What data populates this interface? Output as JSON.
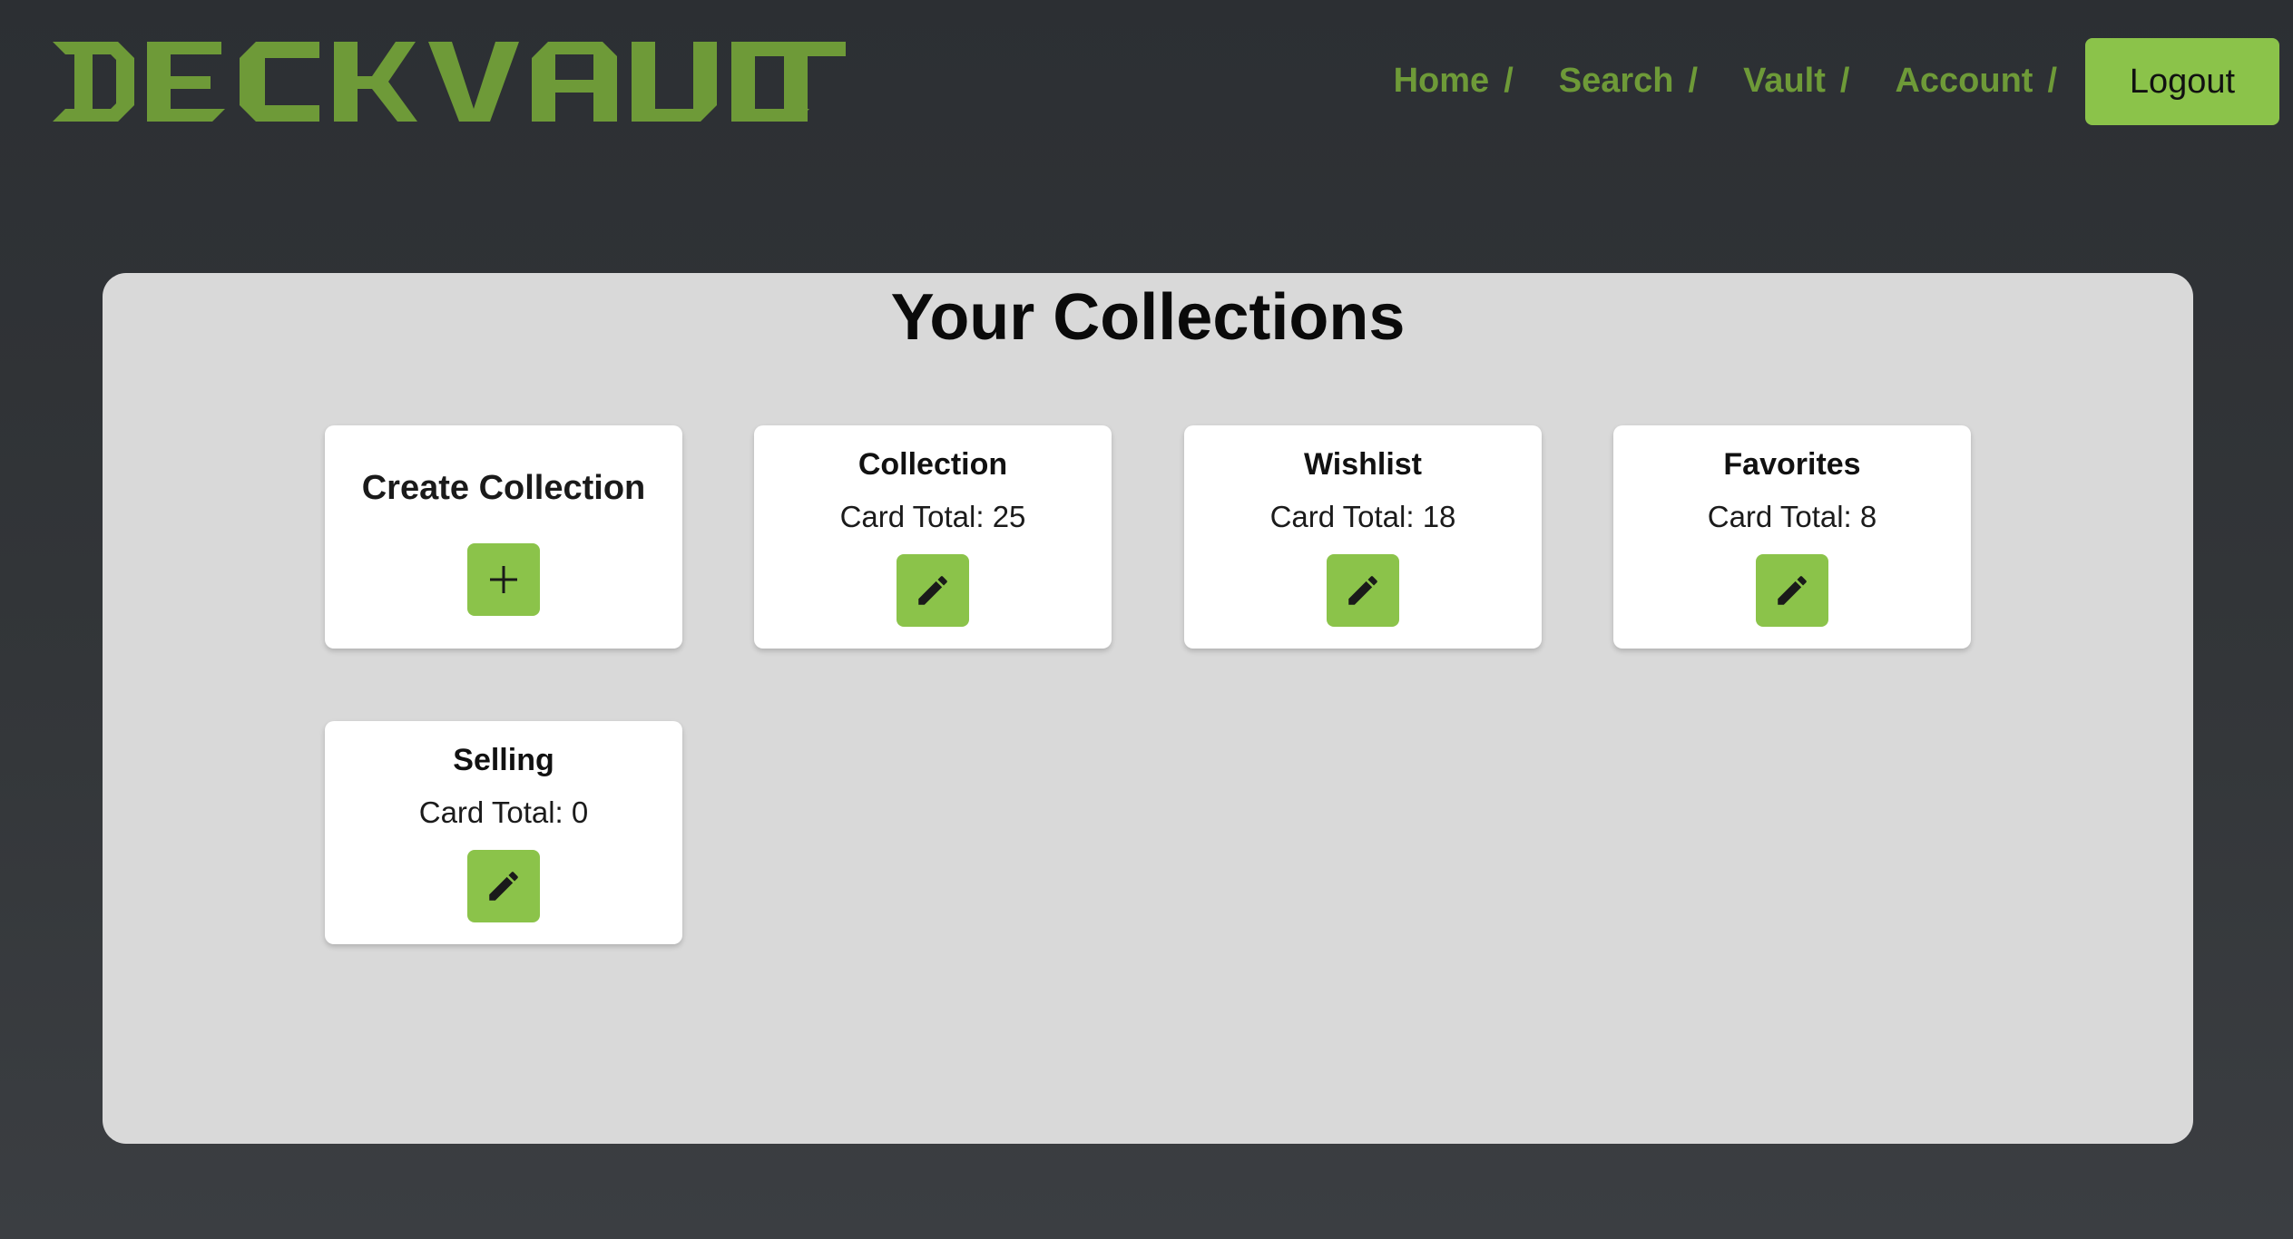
{
  "app": {
    "logo_text": "DECKVAULT",
    "brand_color": "#6e9a38",
    "accent_color": "#8bc34a"
  },
  "nav": {
    "items": [
      {
        "label": "Home",
        "separator": "/"
      },
      {
        "label": "Search",
        "separator": "/"
      },
      {
        "label": "Vault",
        "separator": "/"
      },
      {
        "label": "Account",
        "separator": "/"
      }
    ],
    "logout_label": "Logout"
  },
  "main": {
    "title": "Your Collections",
    "create": {
      "title": "Create Collection",
      "icon": "plus-icon"
    },
    "collections": [
      {
        "name": "Collection",
        "total_label": "Card Total: 25",
        "icon": "pencil-icon"
      },
      {
        "name": "Wishlist",
        "total_label": "Card Total: 18",
        "icon": "pencil-icon"
      },
      {
        "name": "Favorites",
        "total_label": "Card Total: 8",
        "icon": "pencil-icon"
      },
      {
        "name": "Selling",
        "total_label": "Card Total: 0",
        "icon": "pencil-icon"
      }
    ]
  }
}
